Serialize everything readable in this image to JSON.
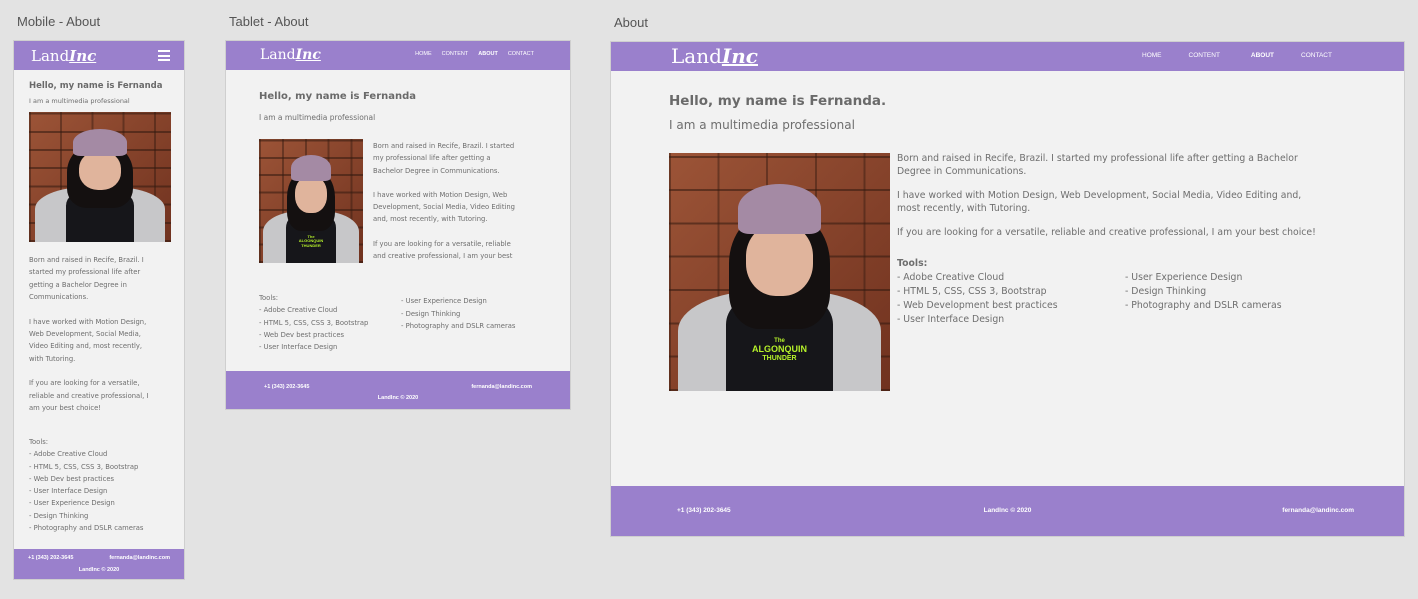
{
  "artboards": {
    "mobile": "Mobile - About",
    "tablet": "Tablet - About",
    "desktop": "About"
  },
  "brand": {
    "land": "Land",
    "inc": "Inc"
  },
  "colors": {
    "accent": "#9a80cc",
    "background": "#f2f2f2",
    "canvas": "#e3e3e3"
  },
  "nav": {
    "home": "HOME",
    "content": "CONTENT",
    "about": "ABOUT",
    "contact": "CONTACT",
    "menu_icon": "hamburger-menu-icon"
  },
  "mobile": {
    "greeting": "Hello, my name is Fernanda",
    "subtitle": "I am a multimedia professional",
    "p1": [
      "Born and raised in Recife, Brazil. I",
      "started my professional life after",
      "getting a Bachelor Degree in",
      "Communications."
    ],
    "p2": [
      "I have worked with Motion Design,",
      "Web Development, Social Media,",
      "Video Editing and, most recently,",
      "with Tutoring."
    ],
    "p3": [
      "If you are looking for a versatile,",
      "reliable and creative professional, I",
      "am your best choice!"
    ],
    "tools_title": "Tools:",
    "tools": [
      "- Adobe Creative Cloud",
      "- HTML 5, CSS, CSS 3, Bootstrap",
      "- Web Dev best practices",
      "- User Interface Design",
      "- User Experience Design",
      "- Design Thinking",
      "- Photography and DSLR cameras"
    ]
  },
  "tablet": {
    "greeting": "Hello, my name is Fernanda",
    "subtitle": "I am a multimedia professional",
    "p1": [
      "Born and raised in Recife, Brazil. I started",
      "my professional life after getting a",
      "Bachelor Degree in Communications."
    ],
    "p2": [
      "I have worked with Motion Design, Web",
      "Development, Social Media, Video Editing",
      "and, most recently, with Tutoring."
    ],
    "p3": [
      "If you are looking for a versatile, reliable",
      "and creative professional, I am your best"
    ],
    "tools_title": "Tools:",
    "tools_left": [
      "- Adobe Creative Cloud",
      "- HTML 5, CSS, CSS 3, Bootstrap",
      "- Web Dev best practices",
      "- User Interface Design"
    ],
    "tools_right": [
      "- User Experience Design",
      "- Design Thinking",
      "- Photography and DSLR cameras"
    ]
  },
  "desktop": {
    "greeting": "Hello, my name is Fernanda.",
    "subtitle": "I am a multimedia professional",
    "p1": [
      "Born and raised in Recife, Brazil. I started my professional life after getting a Bachelor",
      "Degree in Communications."
    ],
    "p2": [
      "I have worked with Motion Design, Web Development, Social Media, Video Editing and,",
      "most recently, with Tutoring."
    ],
    "p3": [
      "If you are looking for a versatile, reliable and creative professional, I am your best choice!"
    ],
    "tools_title": "Tools:",
    "tools_left": [
      "- Adobe Creative Cloud",
      "- HTML 5, CSS, CSS 3, Bootstrap",
      "- Web Development best practices",
      "- User Interface Design"
    ],
    "tools_right": [
      "- User Experience Design",
      "- Design Thinking",
      "- Photography and DSLR cameras"
    ]
  },
  "photo": {
    "shirt_line1": "The",
    "shirt_line2": "ALGONQUIN",
    "shirt_line3": "THUNDER"
  },
  "footer": {
    "phone": "+1 (343) 202-3645",
    "copyright": "LandInc © 2020",
    "email": "fernanda@landinc.com"
  }
}
